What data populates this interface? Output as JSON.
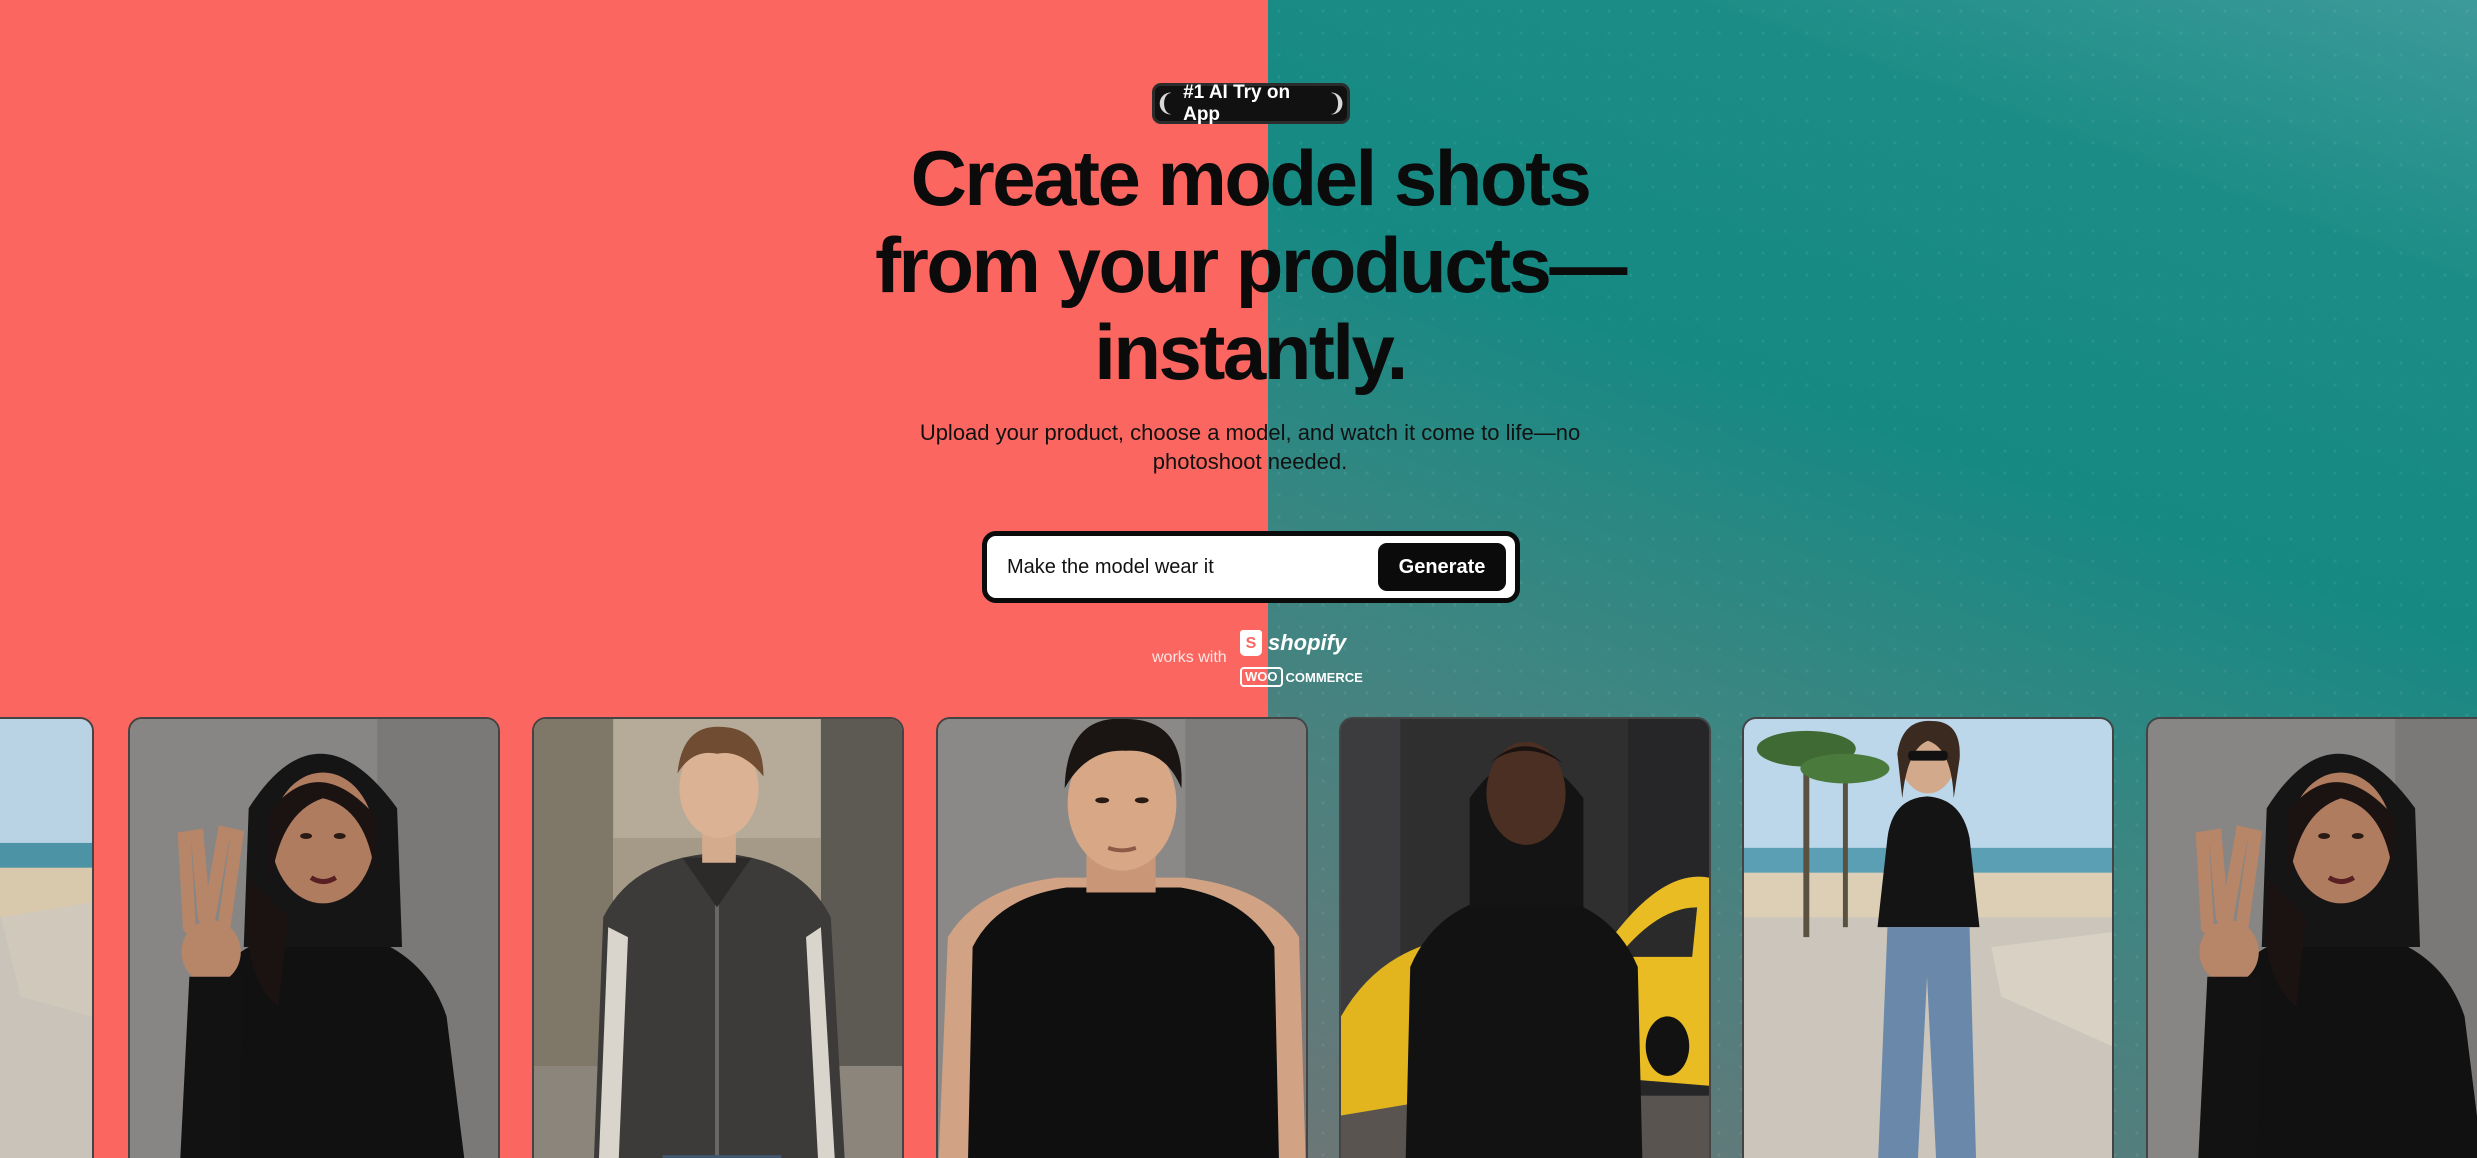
{
  "hero": {
    "badge": "#1 AI Try on App",
    "headline": "Create model shots from your products—instantly.",
    "subheadline": "Upload your product, choose a model, and watch it come to life—no photoshoot needed."
  },
  "prompt": {
    "value": "Make the model wear it",
    "button_label": "Generate"
  },
  "integrations": {
    "label": "works with",
    "platforms": [
      "shopify",
      "WOO",
      "COMMERCE"
    ]
  },
  "colors": {
    "left_background": "#fb6660",
    "right_background": "#1a8a84",
    "text": "#0b0b0b"
  },
  "gallery": {
    "cards": [
      {
        "name": "beach-promenade-photo",
        "icon": "photo-icon"
      },
      {
        "name": "woman-black-hoodie-peace-sign-photo",
        "icon": "photo-icon"
      },
      {
        "name": "man-grey-track-jacket-street-photo",
        "icon": "photo-icon"
      },
      {
        "name": "man-black-tshirt-portrait-photo",
        "icon": "photo-icon"
      },
      {
        "name": "man-black-hoodie-yellow-car-photo",
        "icon": "photo-icon"
      },
      {
        "name": "woman-black-tshirt-jeans-beach-photo",
        "icon": "photo-icon"
      },
      {
        "name": "woman-black-hoodie-peace-sign-photo",
        "icon": "photo-icon"
      }
    ]
  }
}
